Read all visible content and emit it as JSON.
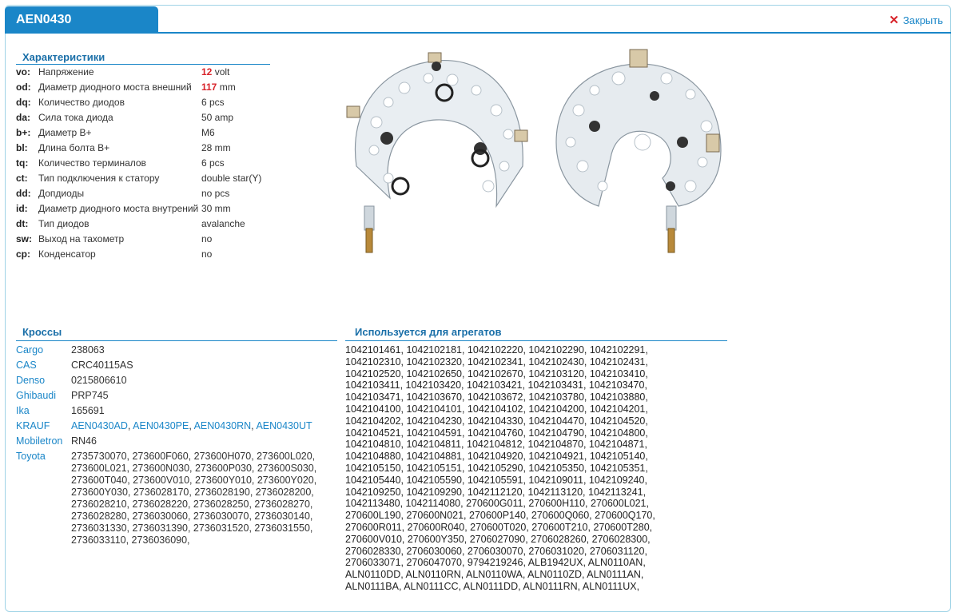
{
  "header": {
    "title": "AEN0430",
    "close_label": "Закрыть"
  },
  "characteristics": {
    "title": "Характеристики",
    "rows": [
      {
        "code": "vo:",
        "label": "Напряжение",
        "value_bold": "12",
        "value": " volt"
      },
      {
        "code": "od:",
        "label": "Диаметр диодного моста внешний",
        "value_bold": "117",
        "value": " mm"
      },
      {
        "code": "dq:",
        "label": "Количество диодов",
        "value_bold": "",
        "value": "6 pcs"
      },
      {
        "code": "da:",
        "label": "Сила тока диода",
        "value_bold": "",
        "value": "50 amp"
      },
      {
        "code": "b+:",
        "label": "Диаметр B+",
        "value_bold": "",
        "value": "M6"
      },
      {
        "code": "bl:",
        "label": "Длина болта B+",
        "value_bold": "",
        "value": "28 mm"
      },
      {
        "code": "tq:",
        "label": "Количество терминалов",
        "value_bold": "",
        "value": "6 pcs"
      },
      {
        "code": "ct:",
        "label": "Тип подключения к статору",
        "value_bold": "",
        "value": "double star(Y)"
      },
      {
        "code": "dd:",
        "label": "Допдиоды",
        "value_bold": "",
        "value": "no pcs"
      },
      {
        "code": "id:",
        "label": "Диаметр диодного моста внутрений",
        "value_bold": "",
        "value": "30 mm"
      },
      {
        "code": "dt:",
        "label": "Тип диодов",
        "value_bold": "",
        "value": "avalanche"
      },
      {
        "code": "sw:",
        "label": "Выход на тахометр",
        "value_bold": "",
        "value": "no"
      },
      {
        "code": "cp:",
        "label": "Конденсатор",
        "value_bold": "",
        "value": "no"
      }
    ]
  },
  "crosses": {
    "title": "Кроссы",
    "rows": [
      {
        "brand": "Cargo",
        "numbers": "238063"
      },
      {
        "brand": "CAS",
        "numbers": "CRC40115AS"
      },
      {
        "brand": "Denso",
        "numbers": "0215806610"
      },
      {
        "brand": "Ghibaudi",
        "numbers": "PRP745"
      },
      {
        "brand": "Ika",
        "numbers": "165691"
      },
      {
        "brand": "KRAUF",
        "links": [
          "AEN0430AD",
          "AEN0430PE",
          "AEN0430RN",
          "AEN0430UT"
        ]
      },
      {
        "brand": "Mobiletron",
        "numbers": "RN46"
      },
      {
        "brand": "Toyota",
        "numbers": "2735730070, 273600F060, 273600H070, 273600L020, 273600L021, 273600N030, 273600P030, 273600S030, 273600T040, 273600V010, 273600Y010, 273600Y020, 273600Y030, 2736028170, 2736028190, 2736028200, 2736028210, 2736028220, 2736028250, 2736028270, 2736028280, 2736030060, 2736030070, 2736030140, 2736031330, 2736031390, 2736031520, 2736031550, 2736033110, 2736036090,"
      }
    ]
  },
  "used_in": {
    "title": "Используется для агрегатов",
    "lines": [
      "1042101461, 1042102181, 1042102220, 1042102290, 1042102291,",
      "1042102310, 1042102320, 1042102341, 1042102430, 1042102431,",
      "1042102520, 1042102650, 1042102670, 1042103120, 1042103410,",
      "1042103411, 1042103420, 1042103421, 1042103431, 1042103470,",
      "1042103471, 1042103670, 1042103672, 1042103780, 1042103880,",
      "1042104100, 1042104101, 1042104102, 1042104200, 1042104201,",
      "1042104202, 1042104230, 1042104330, 1042104470, 1042104520,",
      "1042104521, 1042104591, 1042104760, 1042104790, 1042104800,",
      "1042104810, 1042104811, 1042104812, 1042104870, 1042104871,",
      "1042104880, 1042104881, 1042104920, 1042104921, 1042105140,",
      "1042105150, 1042105151, 1042105290, 1042105350, 1042105351,",
      "1042105440, 1042105590, 1042105591, 1042109011, 1042109240,",
      "1042109250, 1042109290, 1042112120, 1042113120, 1042113241,",
      "1042113480, 1042114080, 270600G011, 270600H110, 270600L021,",
      "270600L190, 270600N021, 270600P140, 270600Q060, 270600Q170,",
      "270600R011, 270600R040, 270600T020, 270600T210, 270600T280,",
      "270600V010, 270600Y350, 2706027090, 2706028260, 2706028300,",
      "2706028330, 2706030060, 2706030070, 2706031020, 2706031120,",
      "2706033071, 2706047070, 9794219246, ALB1942UX, ALN0110AN,",
      "ALN0110DD, ALN0110RN, ALN0110WA, ALN0110ZD, ALN0111AN,",
      "ALN0111BA, ALN0111CC, ALN0111DD, ALN0111RN, ALN0111UX,"
    ]
  },
  "colors": {
    "accent": "#1a86c8",
    "highlight": "#d8232a"
  }
}
